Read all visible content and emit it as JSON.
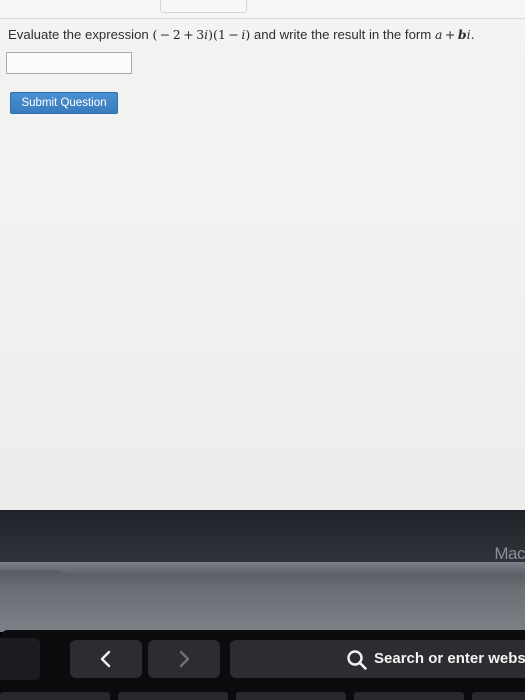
{
  "question": {
    "prefix": "Evaluate the expression",
    "suffix": "and write the result in the form"
  },
  "answer": {
    "value": "",
    "placeholder": ""
  },
  "submit": {
    "label": "Submit Question"
  },
  "bezel": {
    "label": "Mac"
  },
  "touch_bar": {
    "search_label": "Search or enter webs",
    "icons": [
      "chevron-left-icon",
      "chevron-right-icon",
      "search-icon"
    ]
  },
  "colors": {
    "button": "#3a7dbf",
    "screen_bg": "#f2f2f0",
    "touch_bar_bg": "#0b0c0e"
  }
}
